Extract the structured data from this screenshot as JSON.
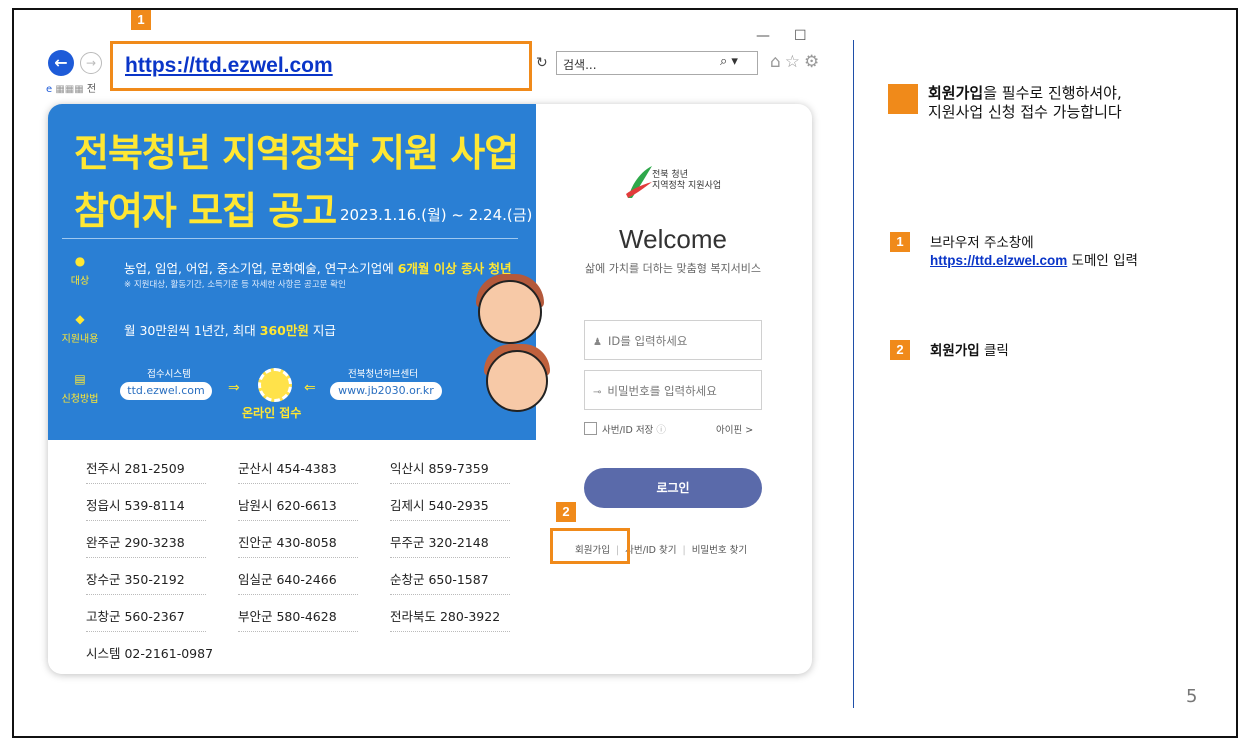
{
  "browser": {
    "address": "https://ttd.ezwel.com",
    "search_placeholder": "검색...",
    "tab_label": "전"
  },
  "badges": {
    "address": "1",
    "join": "2"
  },
  "banner": {
    "title_line1": "전북청년 지역정착 지원 사업",
    "title_line2": "참여자 모집 공고",
    "dates": "2023.1.16.(월) ~ 2.24.(금)",
    "rows": [
      {
        "label": "대상",
        "text": "농업, 임업, 어업, 중소기업, 문화예술, 연구소기업에",
        "highlight": "6개월 이상 종사 청년"
      },
      {
        "label": "지원내용",
        "text": "월 30만원씩 1년간, 최대",
        "highlight": "360만원",
        "suffix": "지급"
      },
      {
        "label": "신청방법"
      }
    ],
    "note": "※ 지원대상, 활동기간, 소득기준 등 자세한 사항은 공고문 확인",
    "apply_system_label": "접수시스템",
    "apply_system_url": "ttd.ezwel.com",
    "hub_label": "전북청년허브센터",
    "hub_url": "www.jb2030.or.kr",
    "online": "온라인 접수"
  },
  "contacts": [
    "전주시 281-2509",
    "군산시 454-4383",
    "익산시 859-7359",
    "정읍시 539-8114",
    "남원시 620-6613",
    "김제시 540-2935",
    "완주군 290-3238",
    "진안군 430-8058",
    "무주군 320-2148",
    "장수군 350-2192",
    "임실군 640-2466",
    "순창군 650-1587",
    "고창군 560-2367",
    "부안군 580-4628",
    "전라북도 280-3922",
    "시스템 02-2161-0987"
  ],
  "login": {
    "logo_line1": "전북 청년",
    "logo_line2": "지역정착 지원사업",
    "welcome": "Welcome",
    "subtitle": "삶에 가치를 더하는 맞춤형 복지서비스",
    "id_placeholder": "ID를 입력하세요",
    "pw_placeholder": "비밀번호를 입력하세요",
    "remember": "사번/ID 저장",
    "ipin": "아이핀 >",
    "login_button": "로그인",
    "join": "회원가입",
    "find_id": "사번/ID 찾기",
    "find_pw": "비밀번호 찾기"
  },
  "notes": {
    "main_bold": "회원가입",
    "main_rest1": "을 필수로 진행하셔야,",
    "main_rest2": "지원사업 신청 접수 가능합니다",
    "step1_badge": "1",
    "step1_text": "브라우저 주소창에",
    "step1_link": "https://ttd.elzwel.com",
    "step1_suffix": " 도메인 입력",
    "step2_badge": "2",
    "step2_bold": "회원가입",
    "step2_suffix": " 클릭"
  },
  "page_number": "5",
  "colors": {
    "accent": "#f08a1a",
    "banner": "#2a7fd4",
    "link": "#0a35c8",
    "login_button": "#5a6aaa"
  }
}
